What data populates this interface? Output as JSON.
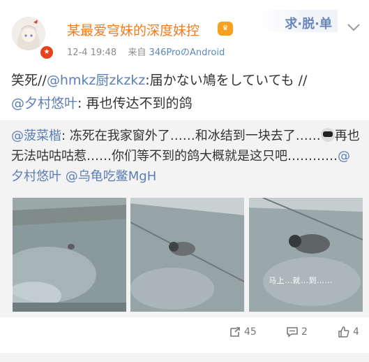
{
  "author": {
    "username": "某最爱穹妹的深度妹控",
    "timestamp": "12-4 19:48",
    "source_prefix": "来自",
    "source": "346ProのAndroid"
  },
  "watermark": "求·脱·单",
  "post": {
    "text_1": "笑死//",
    "mention_1": "@hmkz厨zkzkz",
    "text_2": ":届かない鳩をしていても //",
    "mention_2": "@夕村悠叶",
    "text_3": ": 再也传达不到的鸽"
  },
  "repost": {
    "mention_author": "@菠菜楷",
    "text_1": ": 冻死在我家窗外了……和冰结到一块去了……",
    "text_2": "再也无法咕咕咕惹……你们等不到的鸽大概就是这只吧…………",
    "mention_a": "@夕村悠叶",
    "mention_b": "@乌龟吃鳖MgH",
    "images": [
      {
        "name": "photo-1"
      },
      {
        "name": "photo-2"
      },
      {
        "name": "photo-3",
        "overlay": "马上…就…到……"
      }
    ]
  },
  "actions": {
    "repost_count": "45",
    "comment_count": "2",
    "like_count": "4"
  },
  "icons": {
    "avatar": "avatar-icon",
    "vip": "vip-badge-icon",
    "crown": "crown-icon",
    "chevron": "chevron-down-icon",
    "repost": "repost-icon",
    "comment": "comment-icon",
    "like": "like-icon"
  },
  "colors": {
    "username": "#f37b1d",
    "mention": "#5b7fb5",
    "meta": "#8c8c8c",
    "repost_bg": "#f3f3f3"
  }
}
